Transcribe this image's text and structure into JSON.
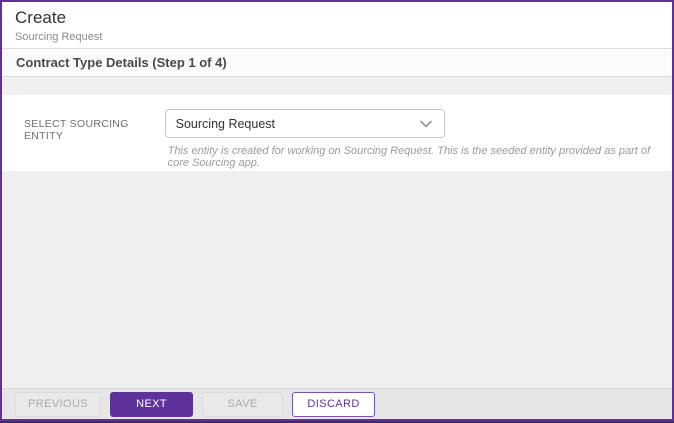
{
  "header": {
    "title": "Create",
    "breadcrumb": "Sourcing Request"
  },
  "section": {
    "title": "Contract Type Details (Step 1 of 4)"
  },
  "form": {
    "label": "SELECT SOURCING ENTITY",
    "dropdown": {
      "value": "Sourcing Request",
      "icon": "chevron-down-icon"
    },
    "helper_text": "This entity is created for working on Sourcing Request. This is the seeded entity provided as part of core Sourcing app."
  },
  "footer": {
    "buttons": [
      {
        "label": "PREVIOUS",
        "state": "disabled",
        "style": "secondary"
      },
      {
        "label": "NEXT",
        "state": "enabled",
        "style": "primary"
      },
      {
        "label": "SAVE",
        "state": "disabled",
        "style": "secondary"
      },
      {
        "label": "DISCARD",
        "state": "enabled",
        "style": "outline"
      }
    ]
  },
  "colors": {
    "primary_purple": "#5f329b",
    "frame_border": "#5f329b",
    "disabled_text": "#ababab",
    "helper_text": "#9b9b9b",
    "panel_gray": "#efefef",
    "footer_gray": "#e6e6e6"
  }
}
